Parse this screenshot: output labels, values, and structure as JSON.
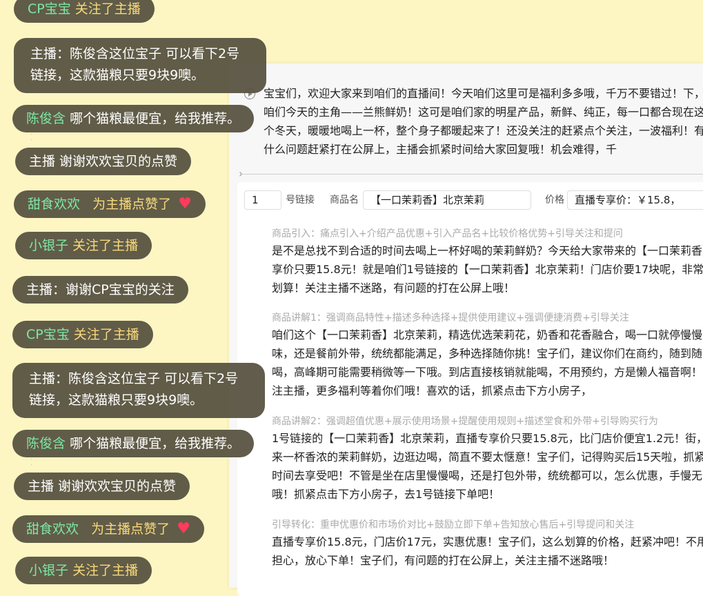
{
  "chat": [
    {
      "name": "CP宝宝",
      "action": "关注了主播"
    },
    {
      "text": "主播：陈俊含这位宝子 可以看下2号链接，这款猫粮只要9块9噢。"
    },
    {
      "name": "陈俊含",
      "text": "哪个猫粮最便宜，给我推荐。"
    },
    {
      "text": "主播 谢谢欢欢宝贝的点赞"
    },
    {
      "name": "甜食欢欢",
      "action": "为主播点赞了"
    },
    {
      "name": "小银子",
      "action": "关注了主播"
    },
    {
      "text": "主播：谢谢CP宝宝的关注"
    },
    {
      "name": "CP宝宝",
      "action": "关注了主播"
    },
    {
      "text": "主播：陈俊含这位宝子 可以看下2号链接，这款猫粮只要9块9噢。"
    },
    {
      "name": "陈俊含",
      "text": "哪个猫粮最便宜，给我推荐。"
    },
    {
      "text": "主播 谢谢欢欢宝贝的点赞"
    },
    {
      "name": "甜食欢欢",
      "action": "为主播点赞了"
    },
    {
      "name": "小银子",
      "action": "关注了主播"
    }
  ],
  "heart_icon": "♥",
  "intro_script": "宝宝们，欢迎大家来到咱们的直播间！今天咱们这里可是福利多多哦，千万不要错过！下，咱们今天的主角——兰熊鲜奶！这可是咱们家的明星产品，新鲜、纯正，每一口都合现在这个冬天，暖暖地喝上一杯，整个身子都暖起来了！还没关注的赶紧点个关注，一波福利！有什么问题赶紧打在公屏上，主播会抓紧时间给大家回复哦！机会难得，千",
  "form": {
    "link_no": "1",
    "link_label": "号链接",
    "product_label": "商品名",
    "product_value": "【一口茉莉香】北京茉莉",
    "price_label": "价格",
    "price_value": "直播专享价：￥15.8，"
  },
  "sections": [
    {
      "heading": "商品引入：痛点引入+介绍产品优惠+引入产品名+比较价格优势+引导关注和提问",
      "text": "是不是总找不到合适的时间去喝上一杯好喝的茉莉鲜奶？今天给大家带来的【一口茉莉香】享价只要15.8元！就是咱们1号链接的【一口茉莉香】北京茉莉！门店价要17块呢，非常划算！关注主播不迷路，有问题的打在公屏上哦！"
    },
    {
      "heading": "商品讲解1：强调商品特性+描述多种选择+提供使用建议+强调便捷消费+引导关注",
      "text": "咱们这个【一口茉莉香】北京茉莉，精选优选茉莉花，奶香和花香融合，喝一口就停慢慢品味，还是餐前外带，统统都能满足，多种选择随你挑！宝子们，建议你们在商约，随到随喝，高峰期可能需要稍微等一下哦。到店直接核销就能喝，不用预约，方是懒人福音啊！关注主播，更多福利等着你们哦！喜欢的话，抓紧点击下方小房子，"
    },
    {
      "heading": "商品讲解2：强调超值优惠+展示使用场景+提醒使用规则+描述堂食和外带+引导购买行为",
      "text": "1号链接的【一口茉莉香】北京茉莉，直播专享价只要15.8元，比门店价便宜1.2元！街，来一杯香浓的茉莉鲜奶，边逛边喝，简直不要太惬意！宝子们，记得购买后15天啦，抓紧时间去享受吧！不管是坐在店里慢慢喝，还是打包外带，统统都可以，怎么优惠，手慢无哦！抓紧点击下方小房子，去1号链接下单吧！"
    },
    {
      "heading": "引导转化：重申优惠价和市场价对比+鼓励立即下单+告知放心售后+引导提问和关注",
      "text": "直播专享价15.8元，门店价17元，实惠优惠！宝子们，这么划算的价格，赶紧冲吧！不用担心，放心下单！宝子们，有问题的打在公屏上，关注主播不迷路哦！"
    }
  ]
}
